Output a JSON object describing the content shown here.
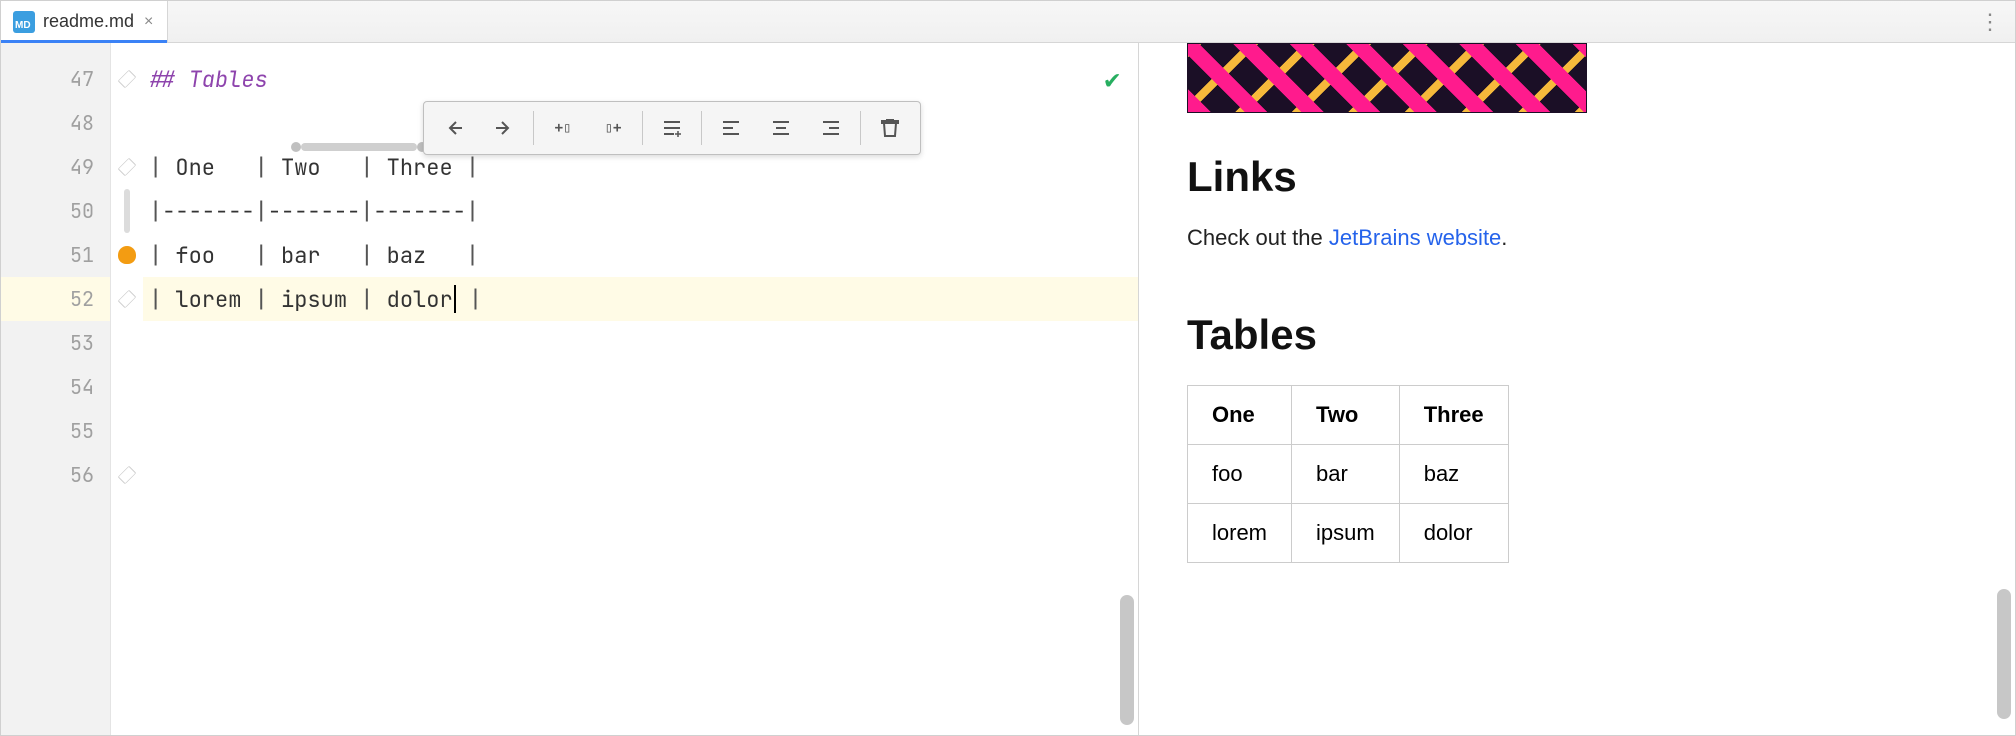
{
  "tab": {
    "filename": "readme.md",
    "icon_label": "MD"
  },
  "editor": {
    "line_numbers": [
      47,
      48,
      49,
      50,
      51,
      52,
      53,
      54,
      55,
      56
    ],
    "heading_line": "## Tables",
    "table_header": [
      "One",
      "Two",
      "Three"
    ],
    "separator_segment": "-------",
    "row1": [
      "foo",
      "bar",
      "baz"
    ],
    "row2": [
      "lorem",
      "ipsum",
      "dolor"
    ],
    "active_line_index": 5,
    "caret_after": "dolor"
  },
  "toolbar": {
    "prev": "Previous",
    "next": "Next",
    "insert_col_before": "Insert column before",
    "insert_col_after": "Insert column after",
    "insert_row": "Insert row",
    "align_left": "Align left",
    "align_center": "Align center",
    "align_right": "Align right",
    "delete": "Delete"
  },
  "status": {
    "ok_tooltip": "No problems"
  },
  "preview": {
    "links_heading": "Links",
    "links_text_prefix": "Check out the ",
    "links_link_text": "JetBrains website",
    "links_text_suffix": ".",
    "tables_heading": "Tables",
    "table": {
      "headers": [
        "One",
        "Two",
        "Three"
      ],
      "rows": [
        [
          "foo",
          "bar",
          "baz"
        ],
        [
          "lorem",
          "ipsum",
          "dolor"
        ]
      ]
    }
  }
}
